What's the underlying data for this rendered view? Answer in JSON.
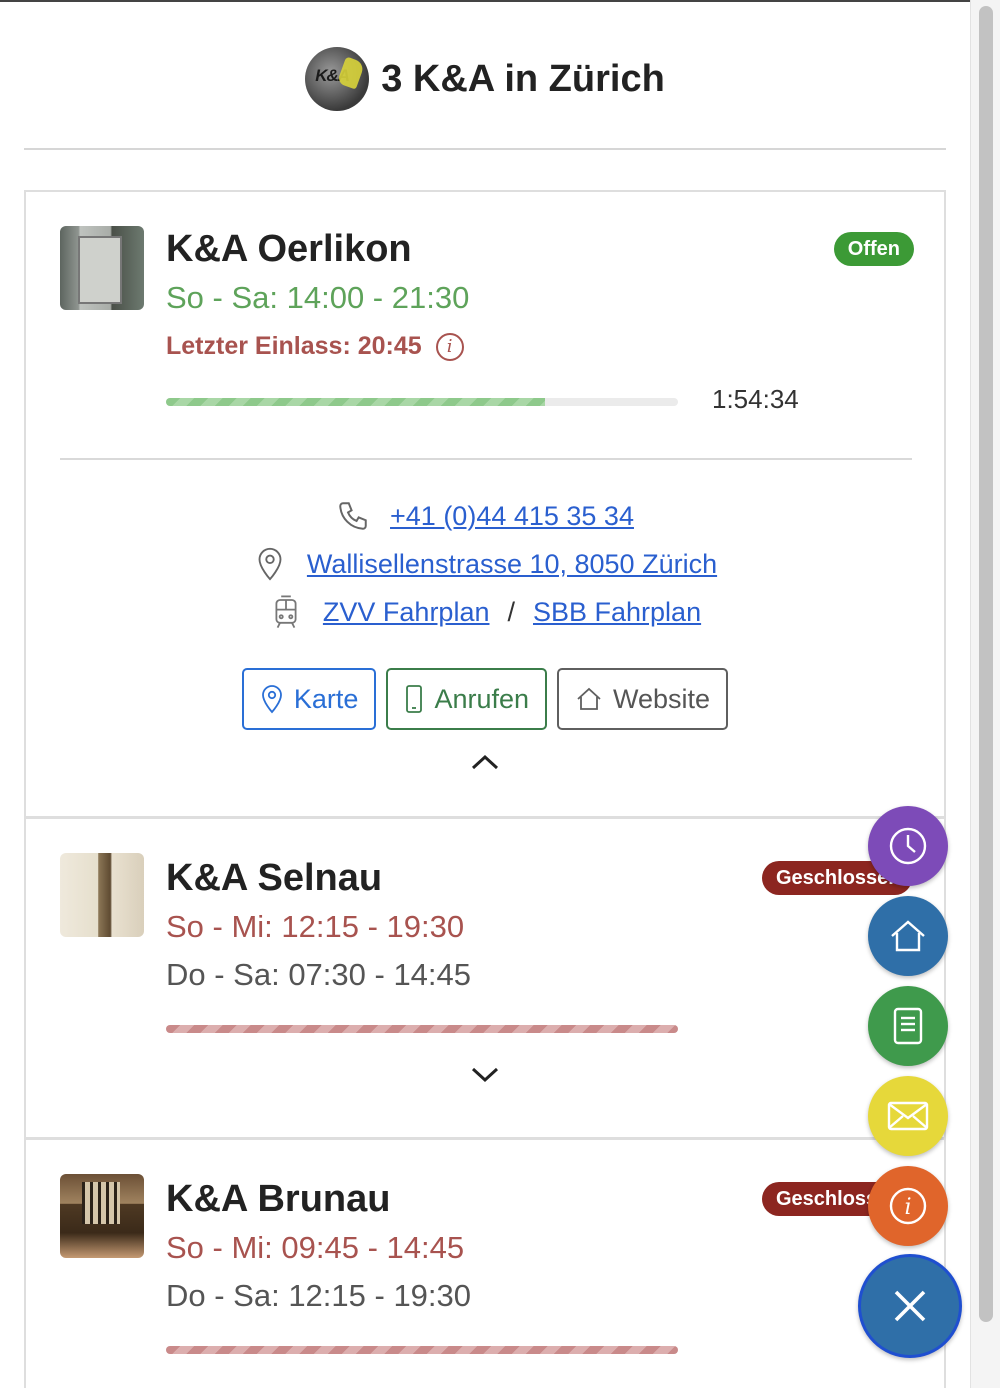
{
  "header": {
    "title": "3 K&A in Zürich"
  },
  "locations": [
    {
      "name": "K&A Oerlikon",
      "status": "Offen",
      "hours": [
        "So - Sa: 14:00 - 21:30"
      ],
      "last_entry": "Letzter Einlass: 20:45",
      "progress_fraction": 0.74,
      "countdown": "1:54:34",
      "phone": "+41 (0)44 415 35 34",
      "address": "Wallisellenstrasse 10, 8050 Zürich",
      "transit": {
        "zvv": "ZVV Fahrplan",
        "separator": "/",
        "sbb": "SBB Fahrplan"
      },
      "buttons": {
        "map": "Karte",
        "call": "Anrufen",
        "website": "Website"
      }
    },
    {
      "name": "K&A Selnau",
      "status": "Geschlossen",
      "hours": [
        "So - Mi: 12:15 - 19:30",
        "Do - Sa: 07:30 - 14:45"
      ]
    },
    {
      "name": "K&A Brunau",
      "status": "Geschlossen",
      "hours": [
        "So - Mi: 09:45 - 14:45",
        "Do - Sa: 12:15 - 19:30"
      ]
    }
  ],
  "fab_menu": [
    {
      "icon": "clock-icon",
      "color": "#7d4bb8"
    },
    {
      "icon": "home-icon",
      "color": "#2f6fa8"
    },
    {
      "icon": "document-icon",
      "color": "#3f9a4c"
    },
    {
      "icon": "envelope-icon",
      "color": "#e6d83a"
    },
    {
      "icon": "info-icon",
      "color": "#e0652b"
    },
    {
      "icon": "close-icon",
      "color": "#2f6fa8"
    }
  ],
  "colors": {
    "open_green": "#3c9a36",
    "closed_red": "#8c2620",
    "link_blue": "#2a5fcf"
  }
}
